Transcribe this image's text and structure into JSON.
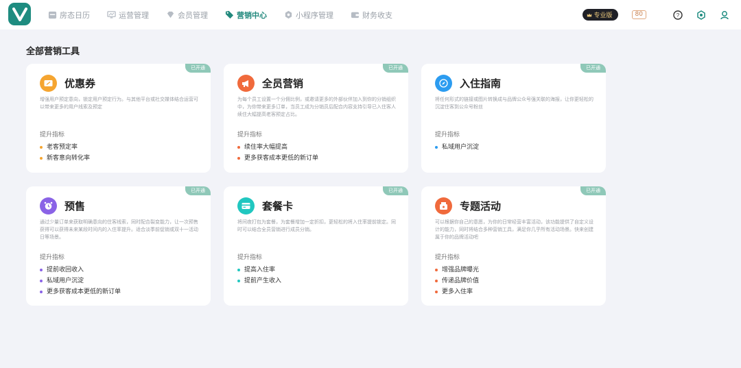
{
  "nav": {
    "items": [
      {
        "label": "房态日历",
        "icon": "calendar-icon"
      },
      {
        "label": "运营管理",
        "icon": "monitor-chart-icon"
      },
      {
        "label": "会员管理",
        "icon": "diamond-icon"
      },
      {
        "label": "营销中心",
        "icon": "tag-icon",
        "active": true
      },
      {
        "label": "小程序管理",
        "icon": "mini-program-icon"
      },
      {
        "label": "财务收支",
        "icon": "wallet-icon"
      }
    ],
    "pro_badge": "专业版",
    "count_badge": "80"
  },
  "section_title": "全部营销工具",
  "opened_label": "已开通",
  "metric_label": "提升指标",
  "cards": [
    {
      "title": "优惠券",
      "icon": "coupon-icon",
      "color": "#f5a531",
      "desc": "增强用户预定意向，锁定用户预定行为。与其他平台或社交媒体结合运营可以带来更多的用户线索及预定",
      "points": [
        "老客预定率",
        "新客意向转化率"
      ]
    },
    {
      "title": "全员营销",
      "icon": "megaphone-icon",
      "color": "#f06a3c",
      "desc": "为每个员工设置一个分佣比例，或邀请更多的外部伙伴加入到你的分销组织中，为你带来更多订单，当员工成为分销员后配合内容支持引导已入住客人续住大幅提高老客预定占比。",
      "points": [
        "续住率大幅提高",
        "更多获客成本更低的新订单"
      ]
    },
    {
      "title": "入住指南",
      "icon": "compass-icon",
      "color": "#2c9cf0",
      "desc": "将任何形式的链接或图片转换成与品牌公众号强关联的海报，让你更轻松的沉淀住客到公众号粉丝",
      "points": [
        "私域用户沉淀"
      ]
    },
    {
      "title": "预售",
      "icon": "alarm-clock-icon",
      "color": "#8a63e6",
      "desc": "通过少量订单来获取明确意向的住客线索，同时配合裂变能力，让一次预售获得可以获得未来某段时间内的入住率提升。适合淡季前促销或双十一活动日等场景。",
      "points": [
        "提前收回收入",
        "私域用户沉淀",
        "更多获客成本更低的新订单"
      ]
    },
    {
      "title": "套餐卡",
      "icon": "card-icon",
      "color": "#21c7c0",
      "desc": "将间夜打包为套餐，为套餐增加一定折扣，更轻松的将入住率提前锁定。同时可以结合全员营销进行成员分销。",
      "points": [
        "提高入住率",
        "提前产生收入"
      ]
    },
    {
      "title": "专题活动",
      "icon": "gift-icon",
      "color": "#f06a3c",
      "desc": "可以根据你自己的意愿，为你的日常经营丰富活动，该功能提供了自定义设计的能力，同时将结合多种营销工具，满足你几乎所有活动场景。快来创建属于你的品牌活动吧",
      "points": [
        "增强品牌曝光",
        "传递品牌价值",
        "更多入住率"
      ]
    }
  ]
}
